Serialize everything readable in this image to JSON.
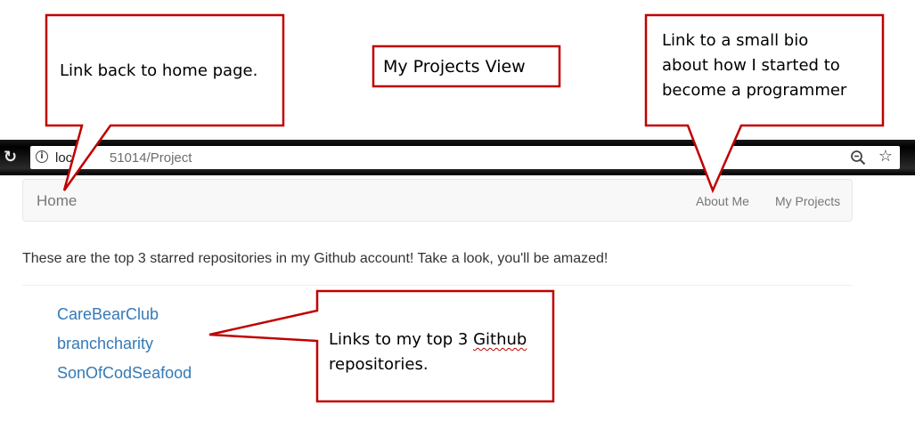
{
  "browser": {
    "url_prefix": "loc",
    "url_rest": "51014/Project",
    "reload_icon": "reload-icon",
    "info_icon": "info-icon",
    "zoom_icon": "zoom-out-icon",
    "star_icon": "bookmark-star-icon"
  },
  "navbar": {
    "brand": "Home",
    "links": [
      "About Me",
      "My Projects"
    ]
  },
  "intro": "These are the top 3 starred repositories in my Github account! Take a look, you'll be amazed!",
  "repositories": [
    "CareBearClub",
    "branchcharity",
    "SonOfCodSeafood"
  ],
  "annotations": {
    "home": "Link back to home page.",
    "title": "My Projects View",
    "bio_lines": [
      "Link to a small bio",
      "about how I started to",
      "become a programmer"
    ],
    "repos_line1": "Links to my top 3 ",
    "repos_github": "Github",
    "repos_line2": "repositories."
  },
  "colors": {
    "callout_border": "#c00000",
    "link": "#337ab7",
    "navbar_bg": "#f8f8f8",
    "nav_text": "#777777"
  }
}
